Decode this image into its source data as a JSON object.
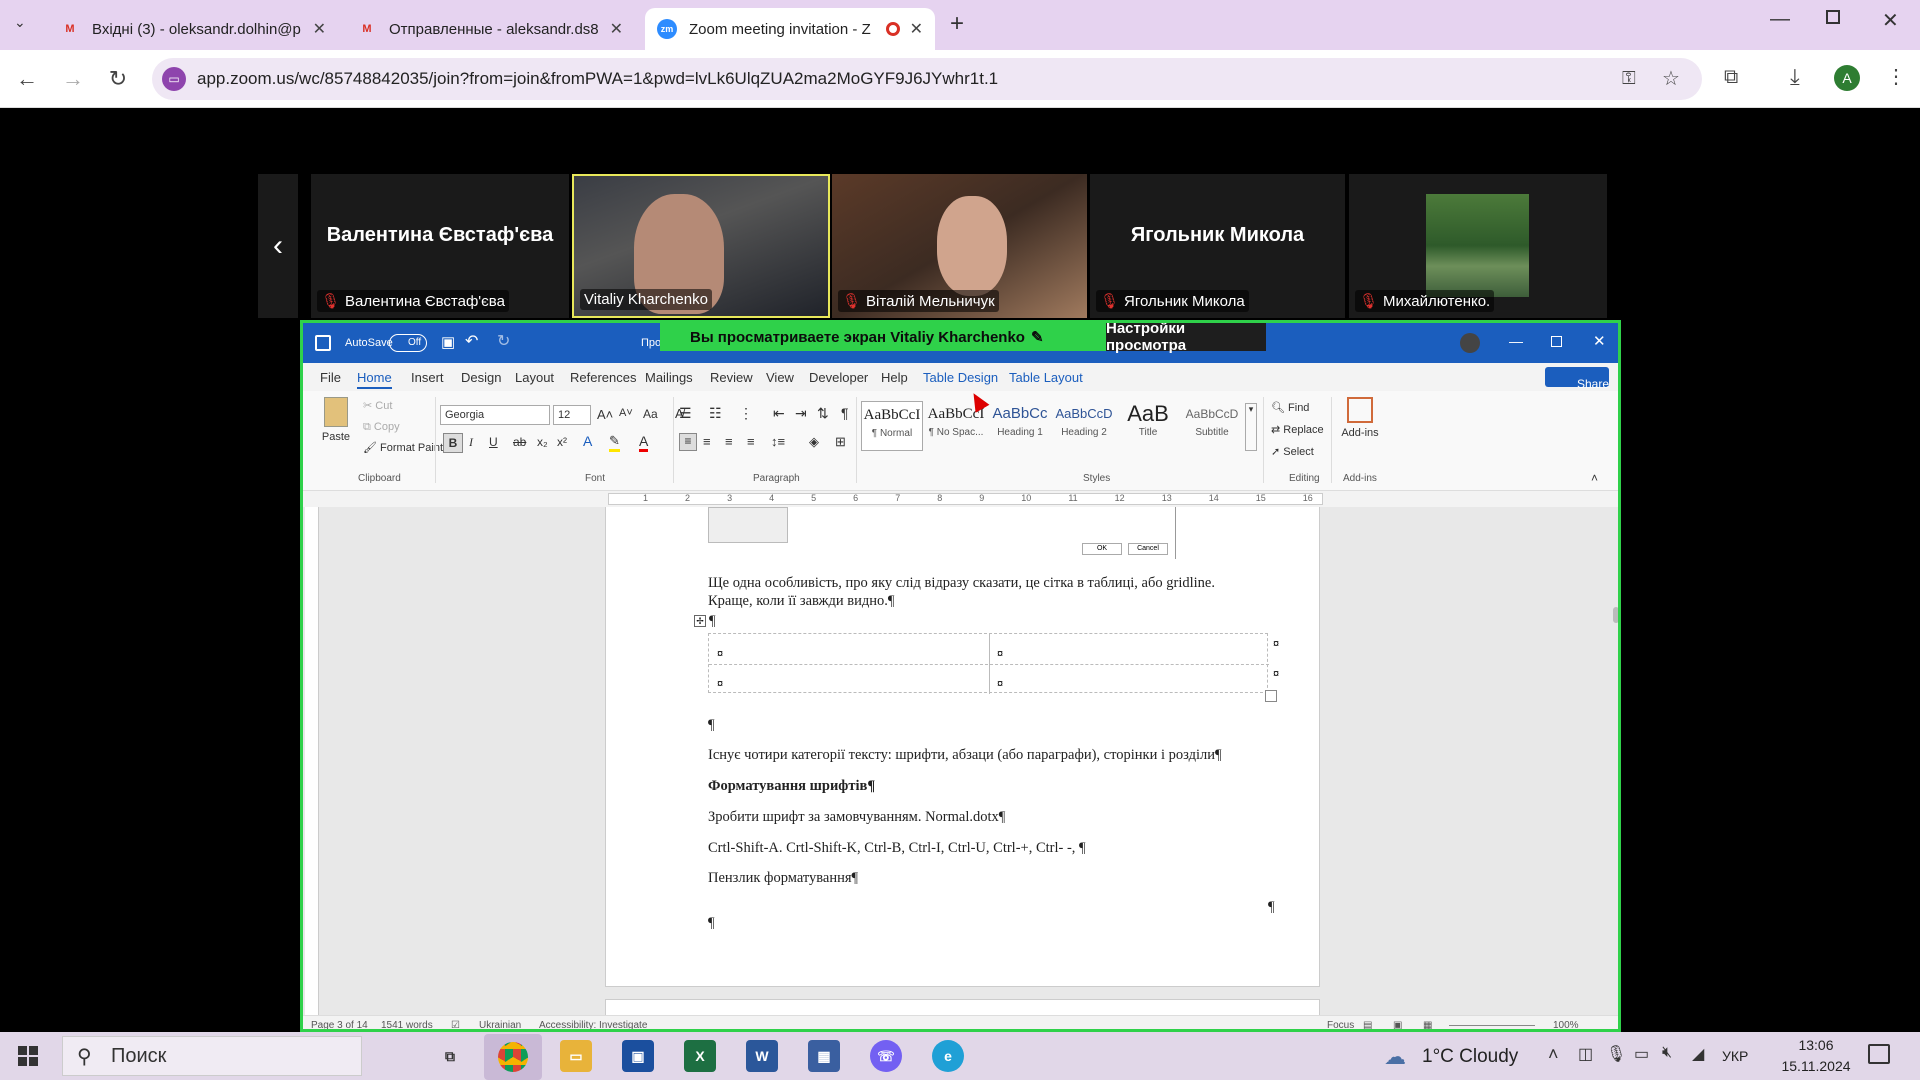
{
  "browser": {
    "tabs": [
      {
        "title": "Вхідні (3) - oleksandr.dolhin@p",
        "icon": "gmail-icon"
      },
      {
        "title": "Отправленные - aleksandr.ds8",
        "icon": "gmail-icon"
      },
      {
        "title": "Zoom meeting invitation - Z",
        "icon": "zoom-icon",
        "active": true
      }
    ],
    "url": "app.zoom.us/wc/85748842035/join?from=join&fromPWA=1&pwd=lvLk6UlqZUA2ma2MoGYF9J6JYwhr1t.1",
    "profile_initial": "A",
    "accent": "#e6d3f0"
  },
  "zoom": {
    "participants": [
      {
        "display": "Валентина Євстаф'єва",
        "label": "Валентина Євстаф'єва",
        "video": false,
        "muted": true
      },
      {
        "display": "",
        "label": "Vitaliy Kharchenko",
        "video": true,
        "muted": false
      },
      {
        "display": "",
        "label": "Віталій Мельничук",
        "video": true,
        "muted": true
      },
      {
        "display": "Ягольник Микола",
        "label": "Ягольник Микола",
        "video": false,
        "muted": true
      },
      {
        "display": "",
        "label": "Михайлютенко.",
        "video": true,
        "muted": true
      }
    ],
    "share_banner": "Вы просматриваете экран  Vitaliy Kharchenko",
    "view_settings": "Настройки просмотра",
    "share_color": "#2fd14a"
  },
  "word": {
    "title_bar": {
      "autosave": "AutoSave",
      "autosave_state": "Off",
      "doc_title": "Про"
    },
    "menu": [
      "File",
      "Home",
      "Insert",
      "Design",
      "Layout",
      "References",
      "Mailings",
      "Review",
      "View",
      "Developer",
      "Help",
      "Table Design",
      "Table Layout"
    ],
    "share": "Share",
    "clipboard": {
      "paste": "Paste",
      "cut": "Cut",
      "copy": "Copy",
      "format_painter": "Format Painter",
      "group": "Clipboard"
    },
    "font": {
      "name": "Georgia",
      "size": "12",
      "group": "Font"
    },
    "paragraph_group": "Paragraph",
    "styles": [
      {
        "preview": "AaBbCcI",
        "name": "¶ Normal"
      },
      {
        "preview": "AaBbCcI",
        "name": "¶ No Spac..."
      },
      {
        "preview": "AaBbCc",
        "name": "Heading 1"
      },
      {
        "preview": "AaBbCcD",
        "name": "Heading 2"
      },
      {
        "preview": "AaB",
        "name": "Title"
      },
      {
        "preview": "AaBbCcD",
        "name": "Subtitle"
      }
    ],
    "styles_group": "Styles",
    "editing": {
      "find": "Find",
      "replace": "Replace",
      "select": "Select",
      "group": "Editing"
    },
    "addins": {
      "label": "Add-ins",
      "group": "Add-ins"
    },
    "ruler_numbers": [
      "1",
      "2",
      "3",
      "4",
      "5",
      "6",
      "7",
      "8",
      "9",
      "10",
      "11",
      "12",
      "13",
      "14",
      "15",
      "16"
    ],
    "dialog": {
      "ok": "OK",
      "cancel": "Cancel"
    },
    "doc": {
      "p1": "Ще одна особливість, про яку слід відразу сказати, це сітка в таблиці, або gridline.",
      "p1b": "Краще, коли її завжди видно.¶",
      "pilcrow": "¶",
      "cell_mark": "¤",
      "p2": "Існує чотири категорії тексту: шрифти, абзаци (або параграфи), сторінки і розділи¶",
      "p3": "Форматування шрифтів¶",
      "p4": "Зробити шрифт за замовчуванням. Normal.dotx¶",
      "p5": "Crtl-Shift-A. Crtl-Shift-K, Ctrl-B, Ctrl-I, Ctrl-U, Ctrl-+, Ctrl- -, ¶",
      "p6": "Пензлик форматування¶"
    },
    "status": {
      "page": "Page 3 of 14",
      "words": "1541 words",
      "language": "Ukrainian",
      "accessibility": "Accessibility: Investigate",
      "focus": "Focus",
      "zoom": "100%"
    }
  },
  "taskbar": {
    "search": "Поиск",
    "weather": "1°C  Cloudy",
    "lang": "УКР",
    "time": "13:06",
    "date": "15.11.2024"
  }
}
